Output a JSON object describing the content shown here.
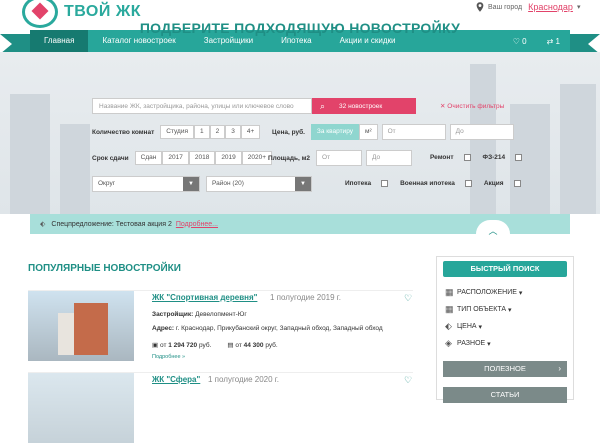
{
  "header": {
    "logo_text": "ТВОЙ ЖК",
    "city_label": "Ваш город",
    "city_name": "Краснодар",
    "caret": "▾"
  },
  "nav": {
    "items": [
      "Главная",
      "Каталог новостроек",
      "Застройщики",
      "Ипотека",
      "Акции и скидки"
    ],
    "fav_count": "0",
    "compare_count": "1",
    "accent": "#27a69a"
  },
  "hero": {
    "title": "ПОДБЕРИТЕ ПОДХОДЯЩУЮ НОВОСТРОЙКУ",
    "search_placeholder": "Название ЖК, застройщика, района, улицы или ключевое слово",
    "search_button": "32 новостроек",
    "clear_filters": "Очистить фильтры"
  },
  "filters": {
    "rooms_label": "Количество комнат",
    "rooms": [
      "Студия",
      "1",
      "2",
      "3",
      "4+"
    ],
    "price_label": "Цена, руб.",
    "price_modes": [
      "За квартиру",
      "м²"
    ],
    "from": "От",
    "to": "До",
    "deadline_label": "Срок сдачи",
    "deadlines": [
      "Сдан",
      "2017",
      "2018",
      "2019",
      "2020+"
    ],
    "area_label": "Площадь, м2",
    "repair_label": "Ремонт",
    "fz_label": "ФЗ-214",
    "district_select": "Округ",
    "area_select": "Район (20)",
    "mortgage_label": "Ипотека",
    "military_label": "Военная ипотека",
    "promo_label": "Акция"
  },
  "promo": {
    "prefix": "Спецпредложение:",
    "text": "Тестовая акция 2",
    "link": "Подробнее..."
  },
  "listings": {
    "title": "ПОПУЛЯРНЫЕ НОВОСТРОЙКИ",
    "items": [
      {
        "name": "ЖК \"Спортивная деревня\"",
        "date": "1 полугодие 2019 г.",
        "dev_label": "Застройщик:",
        "developer": "Девелопмент-Юг",
        "addr_label": "Адрес:",
        "address": "г. Краснодар, Прикубанский округ, Западный обход, Западный обход",
        "price_total_prefix": "от",
        "price_total": "1 294 720",
        "price_total_unit": "руб.",
        "price_m2_prefix": "от",
        "price_m2": "44 300",
        "price_m2_unit": "руб.",
        "more": "Подробнее »"
      },
      {
        "name": "ЖК \"Сфера\"",
        "date": "1 полугодие 2020 г."
      }
    ]
  },
  "sidebar": {
    "quick_search": "БЫСТРЫЙ ПОИСК",
    "items": [
      "РАСПОЛОЖЕНИЕ",
      "ТИП ОБЪЕКТА",
      "ЦЕНА",
      "РАЗНОЕ"
    ],
    "useful": "ПОЛЕЗНОЕ",
    "articles": "СТАТЬИ"
  }
}
